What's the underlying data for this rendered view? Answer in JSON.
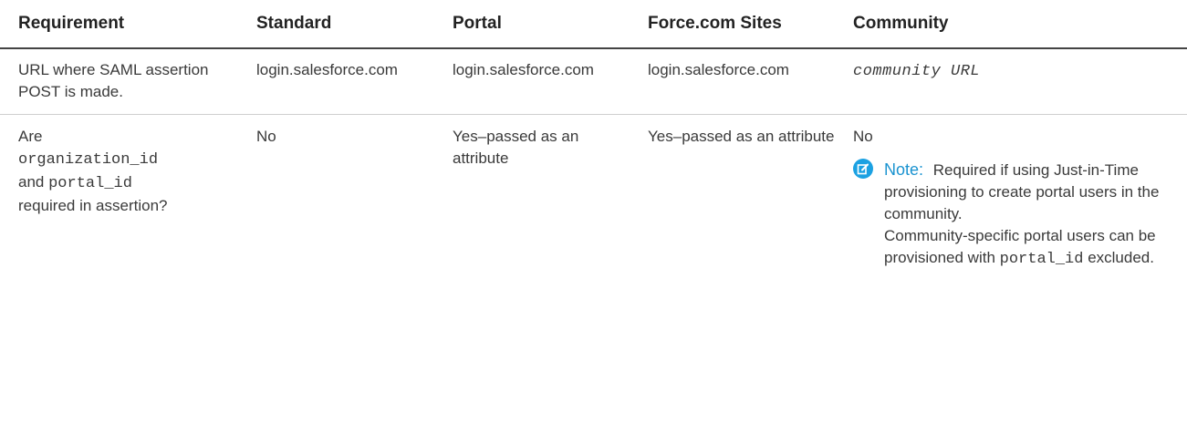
{
  "headers": [
    "Requirement",
    "Standard",
    "Portal",
    "Force.com Sites",
    "Community"
  ],
  "row1": {
    "requirement": "URL where SAML assertion POST is made.",
    "standard": "login.salesforce.com",
    "portal": "login.salesforce.com",
    "sites": "login.salesforce.com",
    "community": "community URL"
  },
  "row2": {
    "req_prefix": "Are",
    "req_code1": "organization_id",
    "req_and": "and",
    "req_code2": "portal_id",
    "req_suffix": "required in assertion?",
    "standard": "No",
    "portal": "Yes–passed as an attribute",
    "sites": "Yes–passed as an attribute",
    "community": "No",
    "note_label": "Note:",
    "note_text": "Required if using Just-in-Time provisioning to create portal users in the community.",
    "note_text2": "Community-specific portal users can be provisioned with",
    "note_code": "portal_id",
    "note_text3": "excluded."
  },
  "colors": {
    "note_icon": "#1ba1e2",
    "note_label": "#1a93d0"
  },
  "icons": {
    "note": "edit-note-icon"
  }
}
